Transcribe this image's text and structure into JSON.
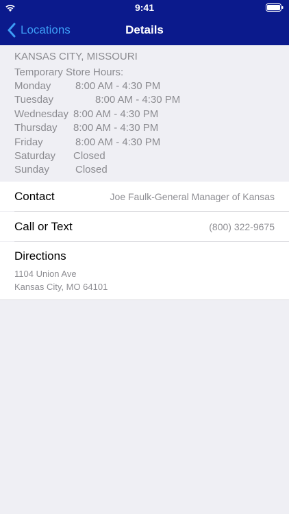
{
  "status_bar": {
    "time": "9:41"
  },
  "nav": {
    "back_label": "Locations",
    "title": "Details"
  },
  "store": {
    "location": "KANSAS CITY, MISSOURI",
    "hours_heading": "Temporary Store Hours:",
    "hours": [
      {
        "day": "Monday",
        "hours": "8:00 AM - 4:30 PM"
      },
      {
        "day": "Tuesday",
        "hours": "8:00 AM - 4:30 PM"
      },
      {
        "day": "Wednesday",
        "hours": "8:00 AM - 4:30 PM"
      },
      {
        "day": "Thursday",
        "hours": "8:00 AM - 4:30 PM"
      },
      {
        "day": "Friday",
        "hours": "8:00 AM - 4:30 PM"
      },
      {
        "day": "Saturday",
        "hours": "Closed"
      },
      {
        "day": "Sunday",
        "hours": "Closed"
      }
    ]
  },
  "contact": {
    "label": "Contact",
    "value": "Joe Faulk-General Manager of Kansas"
  },
  "call": {
    "label": "Call or Text",
    "value": "(800) 322-9675"
  },
  "directions": {
    "label": "Directions",
    "address_line1": "1104 Union Ave",
    "address_line2": "Kansas City, MO 64101"
  },
  "colors": {
    "nav_background": "#0b1a8c",
    "back_tint": "#3d9df6",
    "page_background": "#efeff4"
  }
}
